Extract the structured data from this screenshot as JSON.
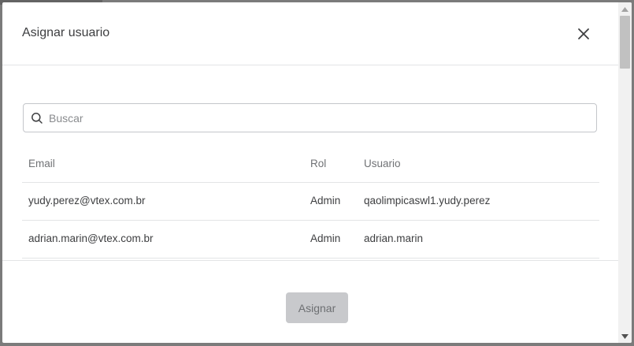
{
  "modal": {
    "title": "Asignar usuario",
    "close_icon": "close-icon"
  },
  "search": {
    "placeholder": "Buscar",
    "value": "",
    "icon": "search-icon"
  },
  "table": {
    "headers": {
      "email": "Email",
      "rol": "Rol",
      "usuario": "Usuario"
    },
    "rows": [
      {
        "email": "yudy.perez@vtex.com.br",
        "rol": "Admin",
        "usuario": "qaolimpicaswl1.yudy.perez"
      },
      {
        "email": "adrian.marin@vtex.com.br",
        "rol": "Admin",
        "usuario": "adrian.marin"
      }
    ]
  },
  "footer": {
    "assign_label": "Asignar"
  },
  "colors": {
    "button_disabled_bg": "#c8c9cc",
    "border": "#e3e4e6",
    "text": "#3d3e40"
  }
}
